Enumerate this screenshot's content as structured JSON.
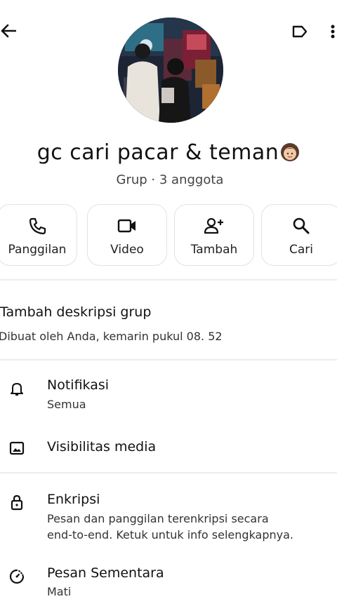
{
  "topbar": {
    "back_icon": "arrow-left-icon",
    "label_icon": "label-tag-icon",
    "more_icon": "more-vertical-icon"
  },
  "group": {
    "name": "gc cari pacar & teman",
    "emoji_icon": "girl-emoji-icon",
    "subtitle": "Grup · 3 anggota"
  },
  "actions": [
    {
      "label": "Panggilan",
      "icon": "phone-icon"
    },
    {
      "label": "Video",
      "icon": "video-camera-icon"
    },
    {
      "label": "Tambah",
      "icon": "add-person-icon"
    },
    {
      "label": "Cari",
      "icon": "search-icon"
    }
  ],
  "description": {
    "add_label": "Tambah deskripsi grup",
    "created_text": "Dibuat oleh Anda,  kemarin pukul 08. 52"
  },
  "settings": {
    "notifications": {
      "title": "Notifikasi",
      "value": "Semua",
      "icon": "bell-icon"
    },
    "media": {
      "title": "Visibilitas media",
      "icon": "image-icon"
    },
    "encryption": {
      "title": "Enkripsi",
      "line1": "Pesan dan panggilan terenkripsi secara",
      "line2": "end-to-end.  Ketuk untuk info selengkapnya.",
      "icon": "lock-icon"
    },
    "disappearing": {
      "title": "Pesan Sementara",
      "value": "Mati",
      "icon": "timer-icon"
    }
  }
}
